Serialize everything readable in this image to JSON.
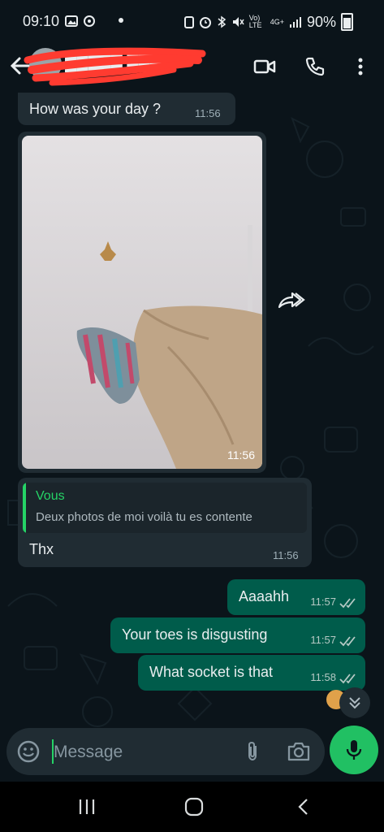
{
  "status_bar": {
    "time": "09:10",
    "network": "Vo) LTE",
    "network_type": "4G+",
    "battery": "90%"
  },
  "header": {
    "contact_name": "█████ ███",
    "icons": [
      "back-arrow-icon",
      "video-call-icon",
      "phone-icon",
      "more-vert-icon"
    ]
  },
  "messages": [
    {
      "direction": "in",
      "text": "How was your day ?",
      "time": "11:56"
    },
    {
      "direction": "in",
      "type": "photo",
      "time": "11:56"
    },
    {
      "direction": "in",
      "quote_author": "Vous",
      "quote_text": "Deux photos de moi voilà tu es contente",
      "text": "Thx",
      "time": "11:56"
    },
    {
      "direction": "out",
      "text": "Aaaahh",
      "time": "11:57"
    },
    {
      "direction": "out",
      "text": "Your toes is disgusting",
      "time": "11:57"
    },
    {
      "direction": "out",
      "text": "What socket is that",
      "time": "11:58"
    }
  ],
  "composer": {
    "placeholder": "Message"
  },
  "colors": {
    "background": "#0b141a",
    "incoming_bubble": "#202c33",
    "outgoing_bubble": "#005c4b",
    "accent": "#21c063"
  }
}
